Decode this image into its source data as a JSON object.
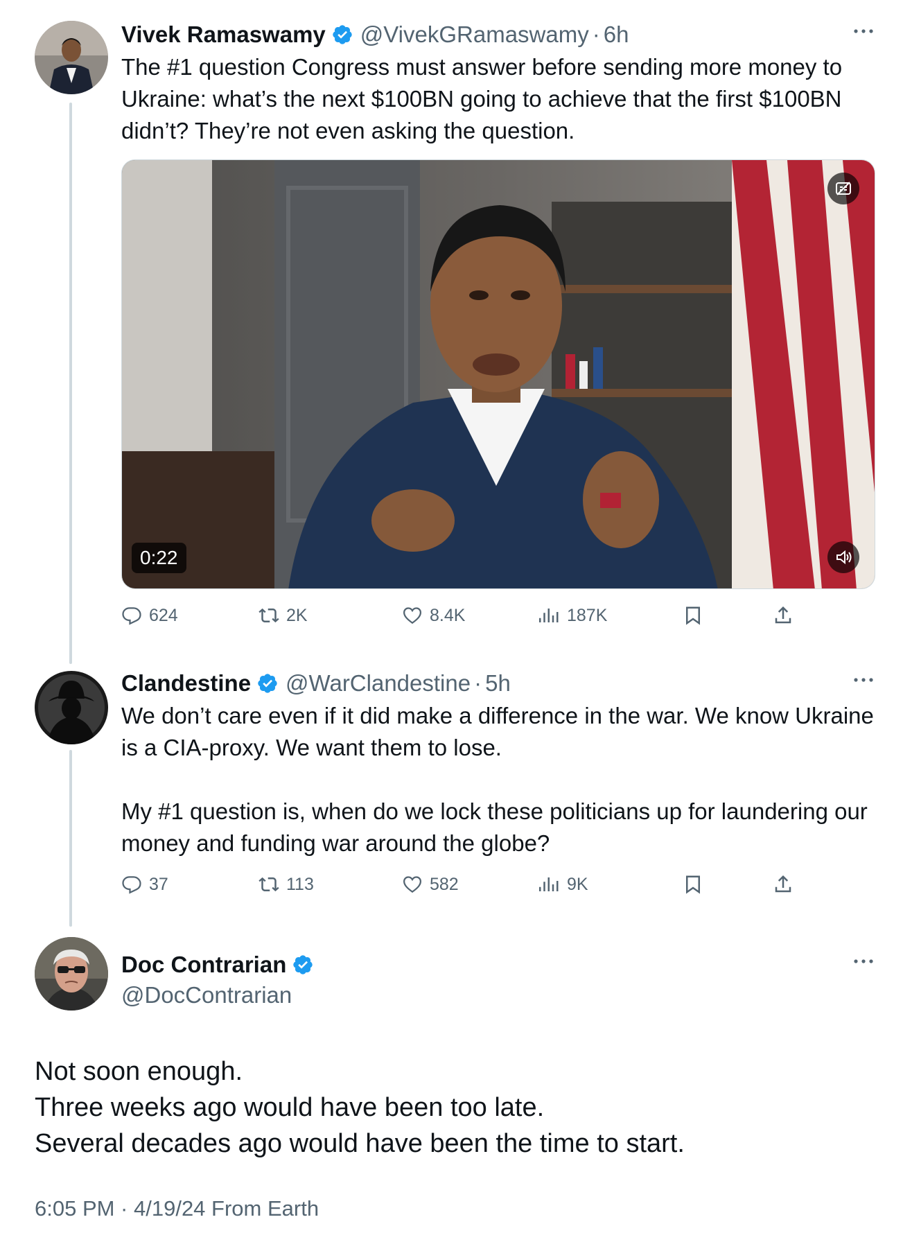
{
  "tweets": [
    {
      "name": "Vivek Ramaswamy",
      "handle": "@VivekGRamaswamy",
      "time": "6h",
      "text": "The #1 question Congress must answer before sending more money to Ukraine: what’s the next $100BN going to achieve that the first $100BN didn’t? They’re not even asking the question.",
      "video_duration": "0:22",
      "replies": "624",
      "reposts": "2K",
      "likes": "8.4K",
      "views": "187K"
    },
    {
      "name": "Clandestine",
      "handle": "@WarClandestine",
      "time": "5h",
      "text_p1": "We don’t care even if it did make a difference in the war. We know Ukraine is a CIA-proxy. We want them to lose.",
      "text_p2": "My #1 question is, when do we lock these politicians up for laundering our money and funding war around the globe?",
      "replies": "37",
      "reposts": "113",
      "likes": "582",
      "views": "9K"
    }
  ],
  "main_tweet": {
    "name": "Doc Contrarian",
    "handle": "@DocContrarian",
    "lines": [
      "Not soon enough.",
      "Three weeks ago would have been too late.",
      "Several decades ago would have been the time to start."
    ],
    "timestamp": "6:05 PM · 4/19/24 From Earth"
  },
  "colors": {
    "verified": "#1d9bf0",
    "secondary_text": "#536471",
    "thread_line": "#cfd9de"
  },
  "icons": [
    "verified-badge-icon",
    "more-icon",
    "reply-icon",
    "repost-icon",
    "like-icon",
    "views-icon",
    "bookmark-icon",
    "share-icon",
    "captions-off-icon",
    "volume-icon"
  ]
}
